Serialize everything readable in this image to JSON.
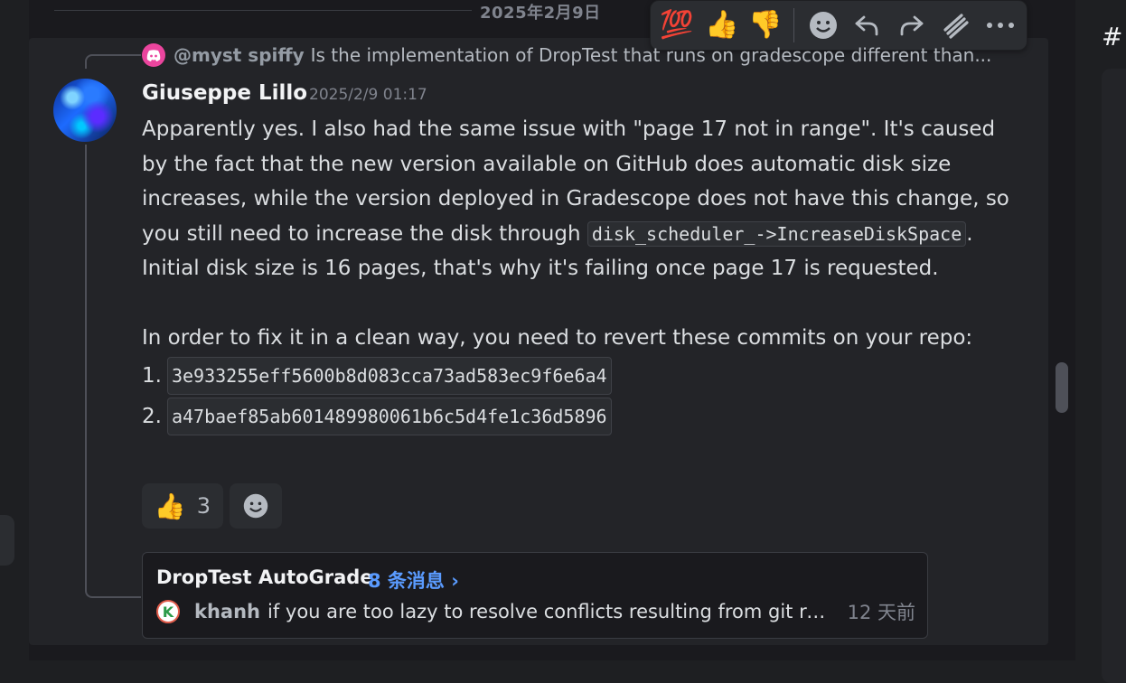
{
  "date_divider": "2025年2月9日",
  "toolbar": {
    "reactions": [
      "💯",
      "👍",
      "👎"
    ],
    "icons": [
      "add-reaction-icon",
      "reply-icon",
      "forward-icon",
      "create-thread-icon",
      "more-icon"
    ]
  },
  "reply": {
    "mention": "@myst spiffy",
    "text": "Is the implementation of DropTest that runs on gradescope different than..."
  },
  "message": {
    "author": "Giuseppe Lillo",
    "timestamp": "2025/2/9 01:17",
    "para1_pre": "Apparently yes. I also had the same issue with \"page 17 not in range\". It's caused by the fact that the new version available on GitHub does automatic disk size increases, while the version deployed in Gradescope does not have this change, so you still need to increase the disk through ",
    "para1_code": "disk_scheduler_->IncreaseDiskSpace",
    "para1_post": ". Initial disk size is 16 pages, that's why it's failing once page 17 is requested.",
    "para2": "In order to fix it in a clean way, you need to revert these commits on your repo:",
    "commits": [
      {
        "num": "1.",
        "hash": "3e933255eff5600b8d083cca73ad583ec9f6e6a4"
      },
      {
        "num": "2.",
        "hash": "a47baef85ab601489980061b6c5d4fe1c36d5896"
      }
    ]
  },
  "reactions": [
    {
      "emoji": "👍",
      "count": "3"
    }
  ],
  "thread": {
    "title": "DropTest AutoGrade",
    "count_label": "8 条消息 ›",
    "last_author_initial": "K",
    "last_author": "khanh",
    "last_text": "if you are too lazy to resolve conflicts resulting from git revert...",
    "last_time": "12 天前"
  },
  "right_panel": {
    "hash_symbol": "#"
  }
}
